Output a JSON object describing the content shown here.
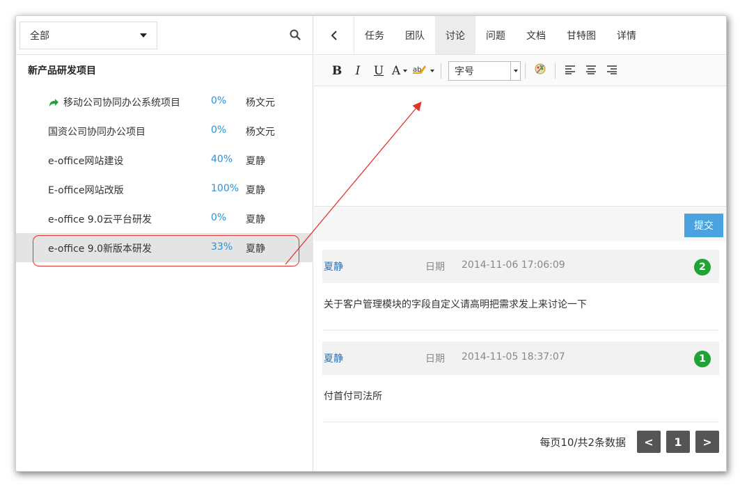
{
  "scope": {
    "selected": "全部"
  },
  "group_title": "新产品研发项目",
  "projects": [
    {
      "name": "移动公司协同办公系统项目",
      "percent": "0%",
      "owner": "杨文元",
      "shared": true
    },
    {
      "name": "国资公司协同办公项目",
      "percent": "0%",
      "owner": "杨文元"
    },
    {
      "name": "e-office网站建设",
      "percent": "40%",
      "owner": "夏静"
    },
    {
      "name": "E-office网站改版",
      "percent": "100%",
      "owner": "夏静"
    },
    {
      "name": "e-office 9.0云平台研发",
      "percent": "0%",
      "owner": "夏静"
    },
    {
      "name": "e-office 9.0新版本研发",
      "percent": "33%",
      "owner": "夏静",
      "selected": true
    }
  ],
  "tabs": [
    "任务",
    "团队",
    "讨论",
    "问题",
    "文档",
    "甘特图",
    "详情"
  ],
  "active_tab": "讨论",
  "toolbar": {
    "bold": "B",
    "italic": "I",
    "underline": "U",
    "font_color": "A",
    "font_size": "字号"
  },
  "submit_label": "提交",
  "comments": [
    {
      "author": "夏静",
      "date_label": "日期",
      "date": "2014-11-06 17:06:09",
      "number": "2",
      "text": "关于客户管理模块的字段自定义请高明把需求发上来讨论一下"
    },
    {
      "author": "夏静",
      "date_label": "日期",
      "date": "2014-11-05 18:37:07",
      "number": "1",
      "text": "付首付司法所"
    }
  ],
  "pager": {
    "info": "每页10/共2条数据",
    "prev": "<",
    "page": "1",
    "next": ">"
  },
  "colors": {
    "accent": "#4aa3df",
    "percent": "#2a90d6",
    "badge": "#1fa335",
    "highlight": "#e0322f"
  }
}
